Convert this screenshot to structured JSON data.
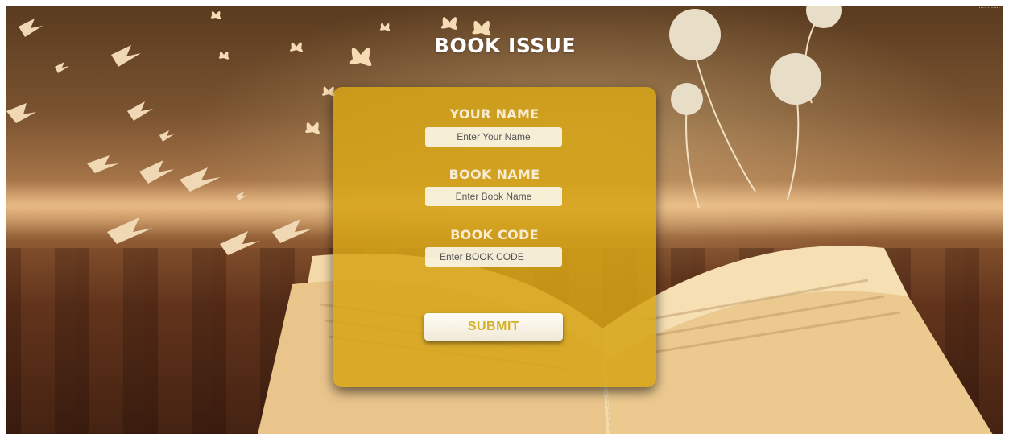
{
  "page": {
    "title": "BOOK ISSUE",
    "corner_text": "···· · ·····"
  },
  "form": {
    "your_name": {
      "label": "YOUR NAME",
      "placeholder": "Enter Your Name"
    },
    "book_name": {
      "label": "BOOK NAME",
      "placeholder": "Enter Book Name"
    },
    "book_code": {
      "label": "BOOK CODE",
      "placeholder": "Enter BOOK CODE"
    },
    "submit_label": "SUBMIT"
  },
  "colors": {
    "panel": "#d6a416",
    "submit_text": "#d4b12a",
    "label_text": "#f7ecd2"
  },
  "background": {
    "description_icons": [
      "bird-icon",
      "butterfly-icon",
      "flower-icon",
      "open-book-image"
    ]
  }
}
